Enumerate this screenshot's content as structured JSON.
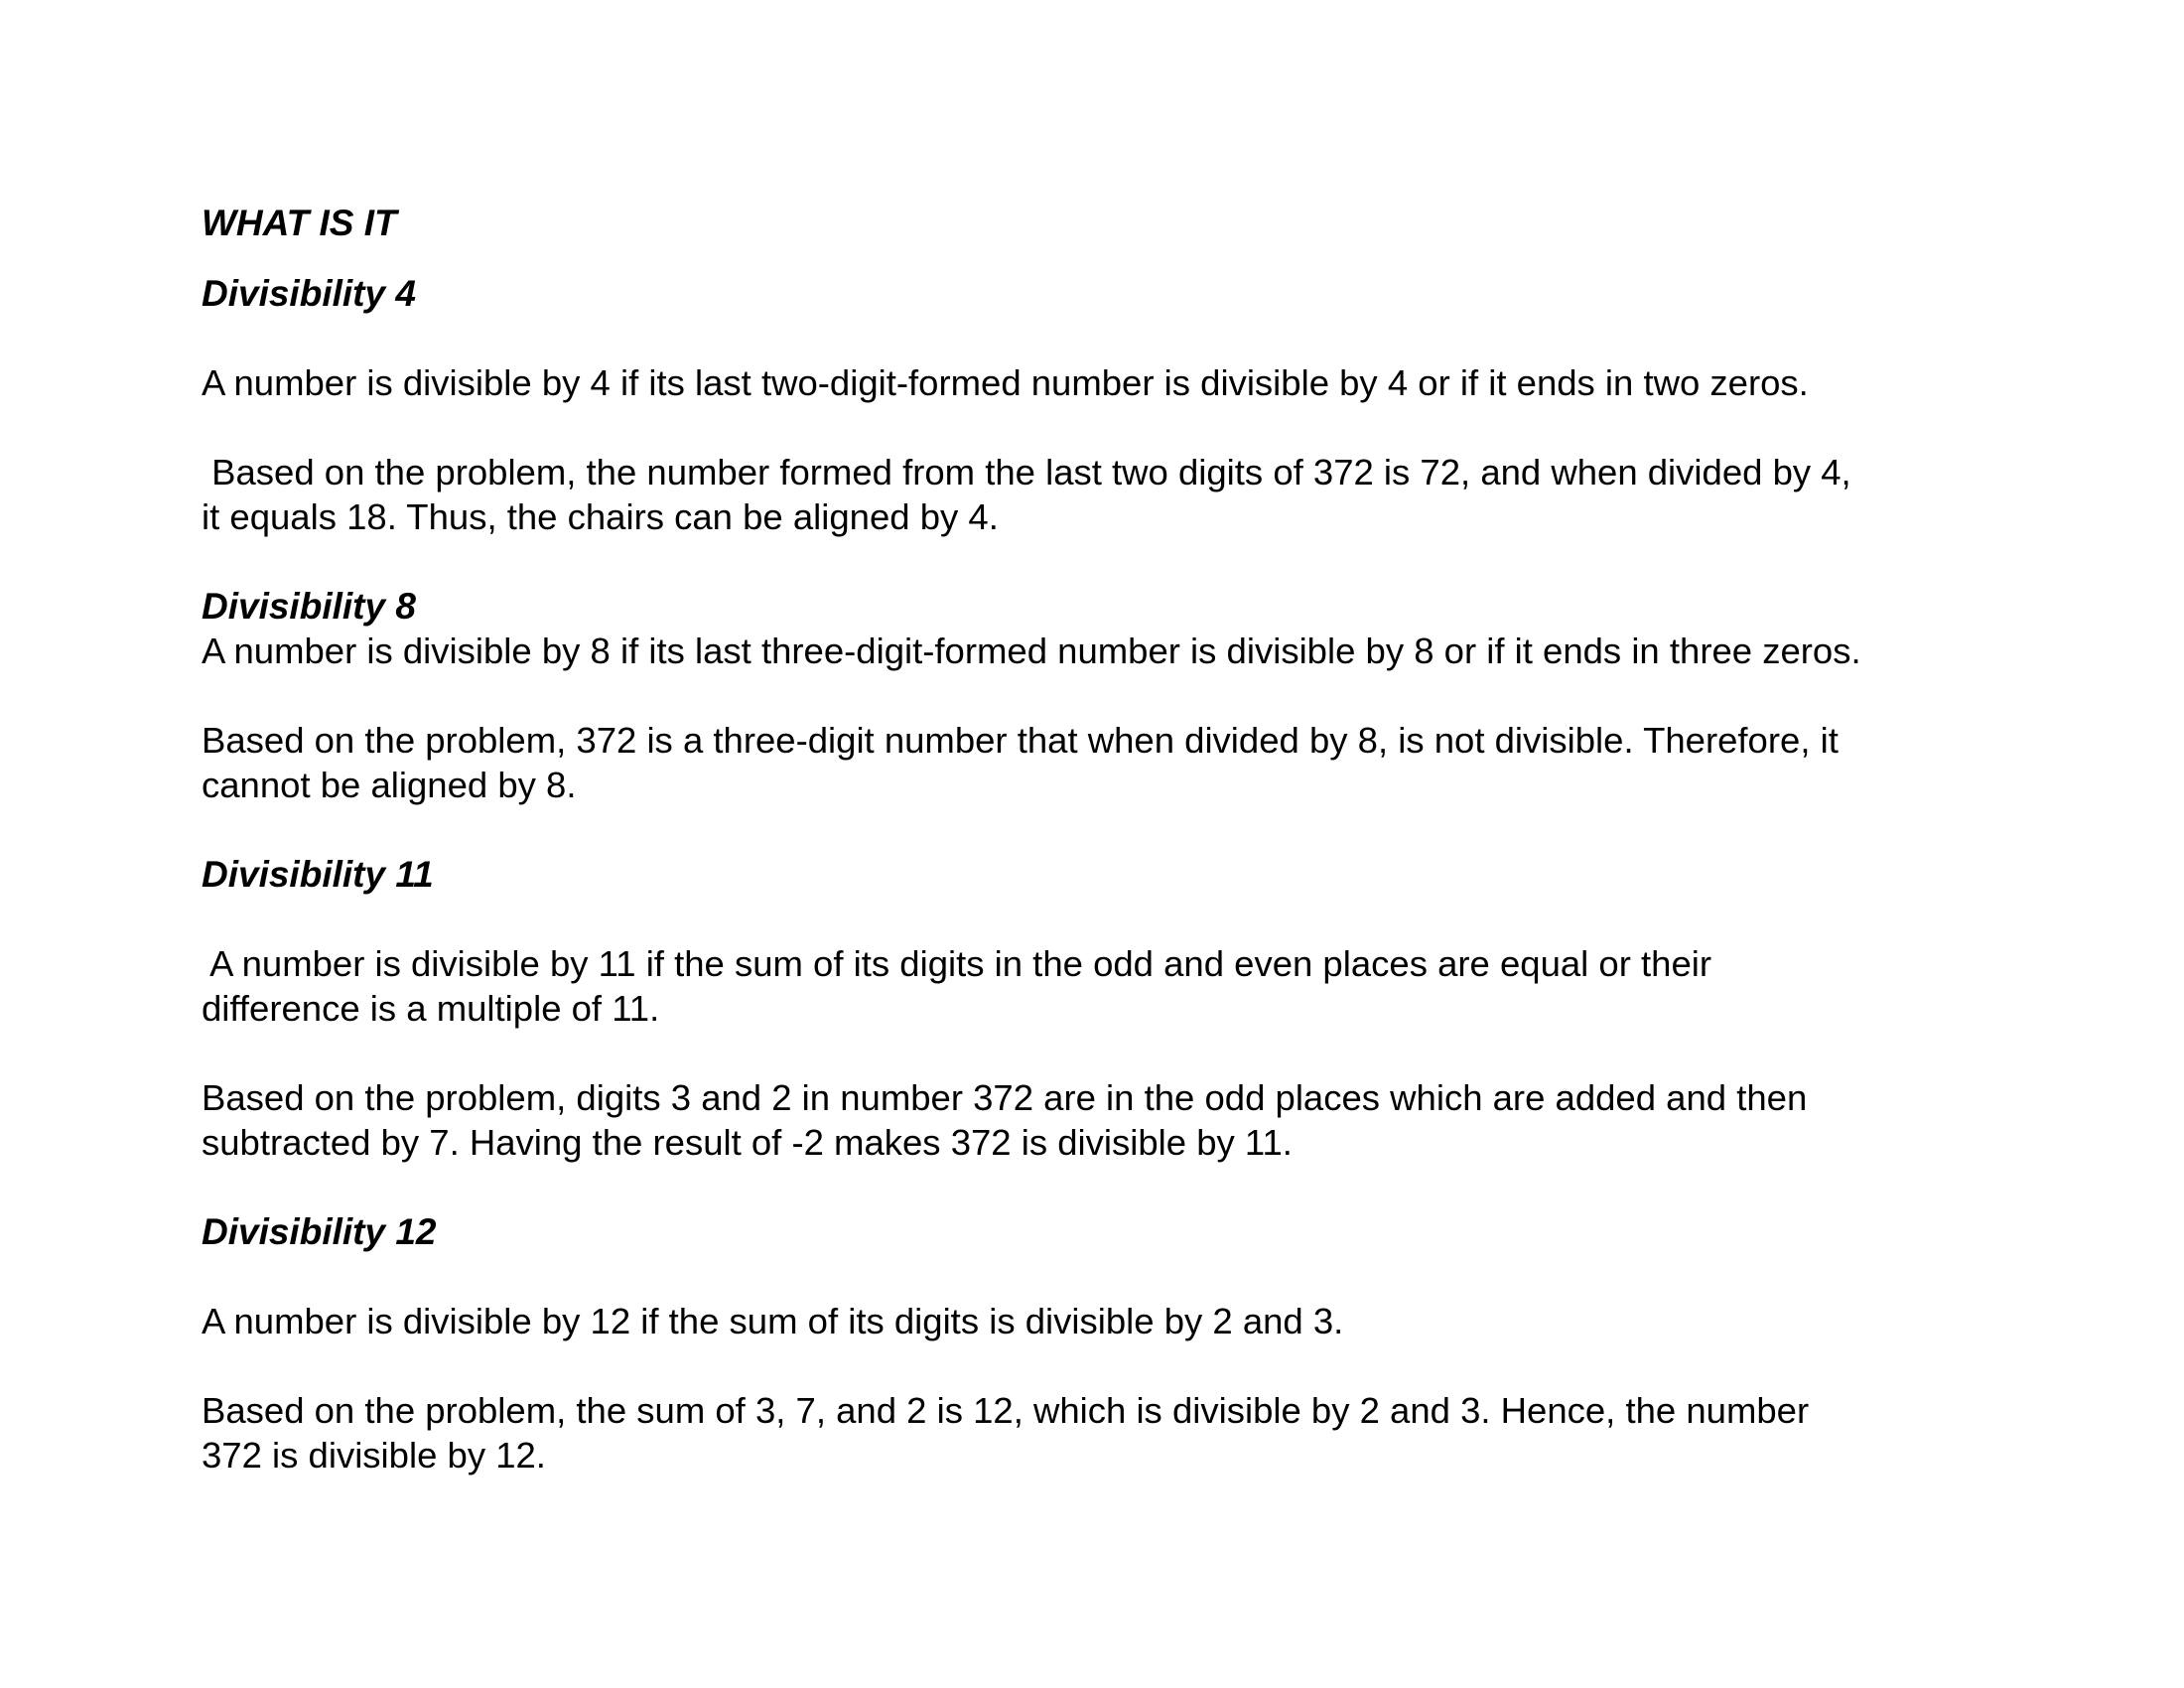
{
  "document": {
    "title": "WHAT IS IT",
    "sections": [
      {
        "heading": "Divisibility 4",
        "rule": [
          "A number is divisible by 4 if its last two-digit-formed number is divisible by 4 or if it ends in two zeros."
        ],
        "explanation": [
          " Based on the problem, the number formed from the last two digits of 372 is 72, and when divided by 4,",
          "it equals 18. Thus, the chairs can be aligned by 4."
        ]
      },
      {
        "heading": "Divisibility 8",
        "rule": [
          "A number is divisible by 8 if its last three-digit-formed number is divisible by 8 or if it ends in three zeros."
        ],
        "explanation": [
          "Based on the problem, 372 is a three-digit number that when divided by 8, is not divisible. Therefore, it",
          "cannot be aligned by 8."
        ]
      },
      {
        "heading": "Divisibility 11",
        "rule": [
          " A number is divisible by 11 if the sum of its digits in the odd and even places are equal or their",
          "difference is a multiple of 11."
        ],
        "explanation": [
          "Based on the problem, digits 3 and 2 in number 372 are in the odd places which are added and then",
          "subtracted by 7. Having the result of -2 makes 372 is divisible by 11."
        ]
      },
      {
        "heading": "Divisibility 12",
        "rule": [
          "A number is divisible by 12 if the sum of its digits is divisible by 2 and 3."
        ],
        "explanation": [
          "Based on the problem, the sum of 3, 7, and 2 is 12, which is divisible by 2 and 3. Hence, the number",
          "372 is divisible by 12."
        ]
      }
    ]
  }
}
